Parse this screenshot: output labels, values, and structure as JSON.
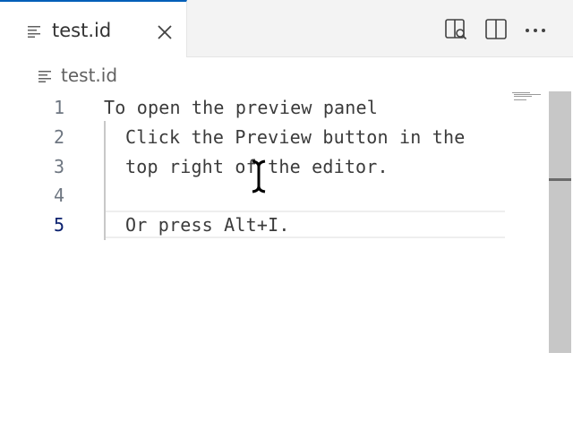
{
  "tab": {
    "label": "test.id"
  },
  "breadcrumb": {
    "label": "test.id"
  },
  "editor": {
    "active_line": "5",
    "lines": [
      {
        "num": "1",
        "text": "To open the preview panel"
      },
      {
        "num": "2",
        "text": "Click the Preview button in the"
      },
      {
        "num": "3",
        "text": "top right of the editor."
      },
      {
        "num": "4",
        "text": ""
      },
      {
        "num": "5",
        "text": "Or press Alt+I."
      }
    ]
  },
  "icons": {
    "tab_file": "file-lines-icon",
    "close": "close-icon",
    "open_preview": "open-preview-icon",
    "split_editor": "split-editor-icon",
    "more_actions": "ellipsis-icon"
  },
  "colors": {
    "accent": "#005fb8",
    "active_line_number": "#0b216f",
    "text": "#3b3b3b",
    "line_number": "#6e7681"
  }
}
